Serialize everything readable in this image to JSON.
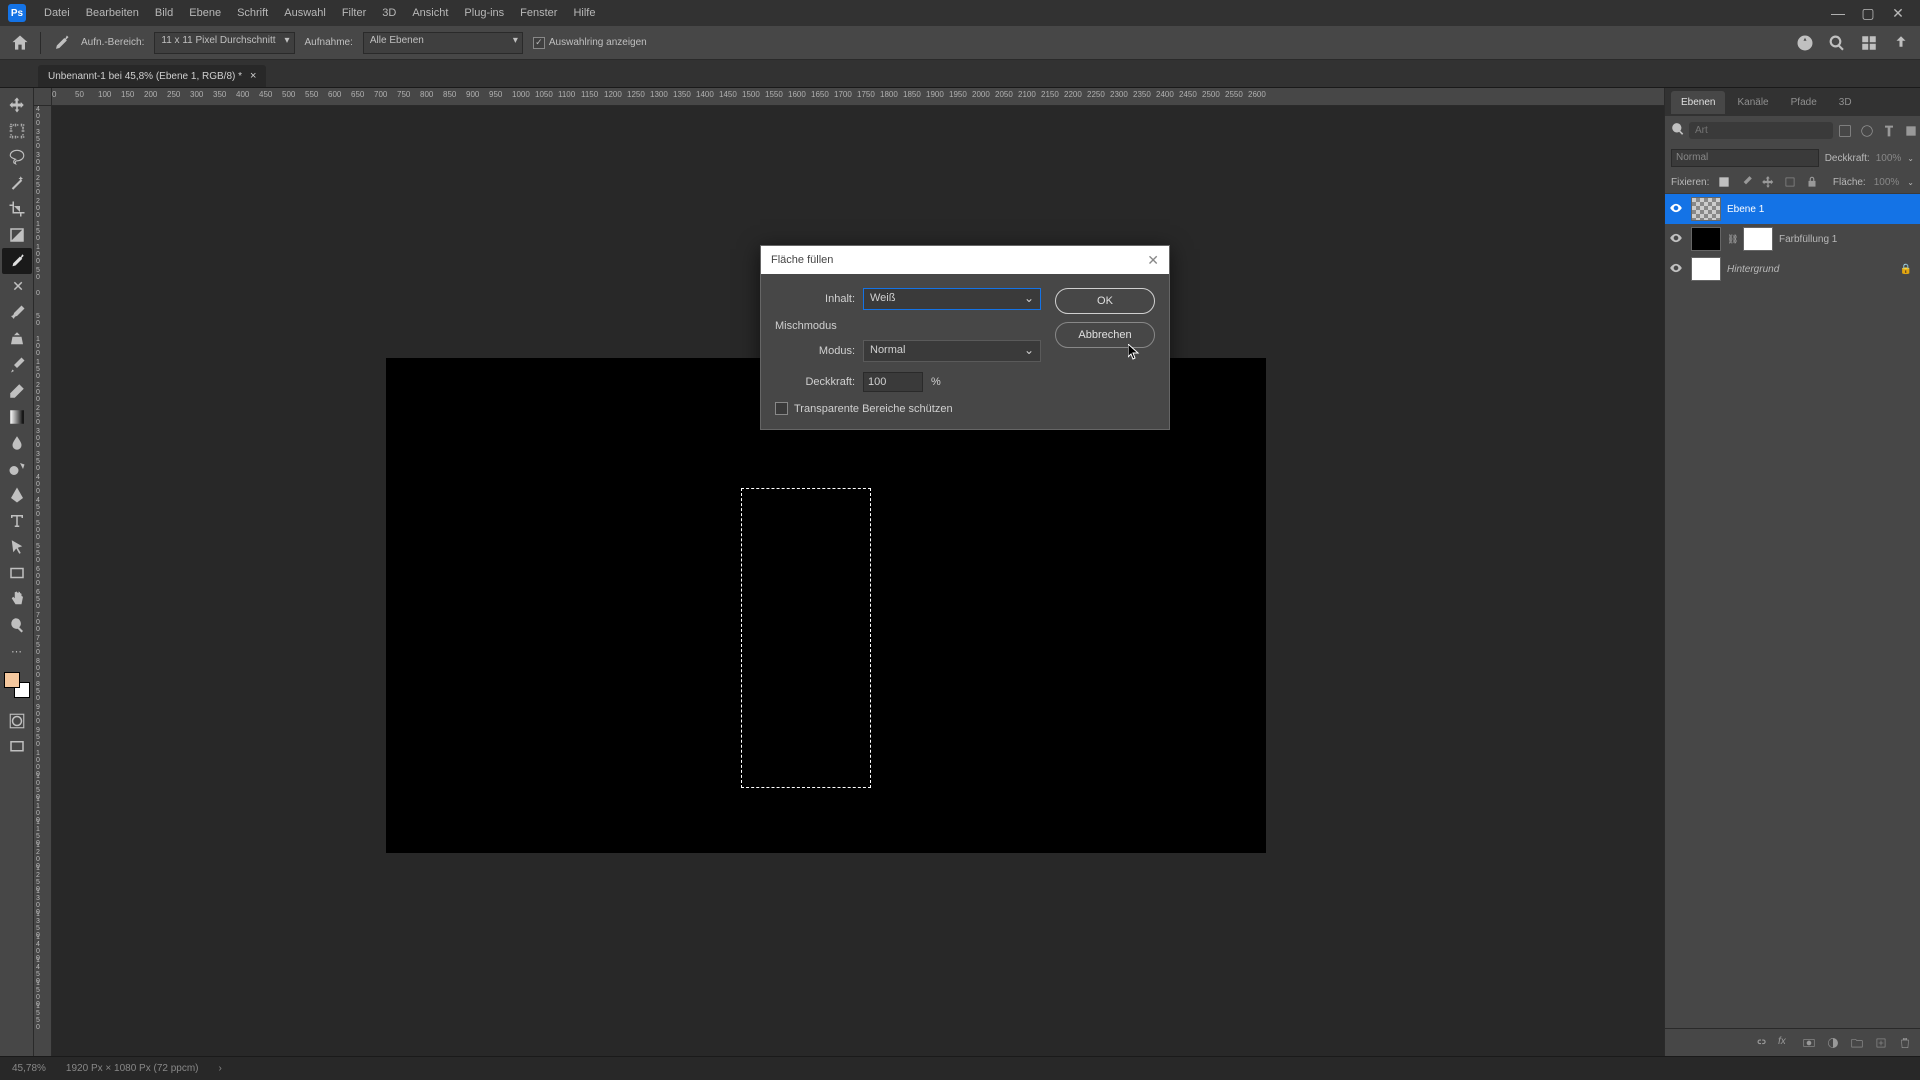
{
  "menubar": {
    "items": [
      "Datei",
      "Bearbeiten",
      "Bild",
      "Ebene",
      "Schrift",
      "Auswahl",
      "Filter",
      "3D",
      "Ansicht",
      "Plug-ins",
      "Fenster",
      "Hilfe"
    ]
  },
  "optionsbar": {
    "sample_label": "Aufn.-Bereich:",
    "sample_value": "11 x 11 Pixel Durchschnitt",
    "sample2_label": "Aufnahme:",
    "sample2_value": "Alle Ebenen",
    "checkbox_label": "Auswahlring anzeigen"
  },
  "doctab": {
    "title": "Unbenannt-1 bei 45,8% (Ebene 1, RGB/8) *"
  },
  "ruler_h": [
    "0",
    "50",
    "100",
    "150",
    "200",
    "250",
    "300",
    "350",
    "400",
    "450",
    "500",
    "550",
    "600",
    "650",
    "700",
    "750",
    "800",
    "850",
    "900",
    "950",
    "1000",
    "1050",
    "1100",
    "1150",
    "1200",
    "1250",
    "1300",
    "1350",
    "1400",
    "1450",
    "1500",
    "1550",
    "1600",
    "1650",
    "1700",
    "1750",
    "1800",
    "1850",
    "1900",
    "1950",
    "2000",
    "2050",
    "2100",
    "2150",
    "2200",
    "2250",
    "2300",
    "2350",
    "2400",
    "2450",
    "2500",
    "2550",
    "2600"
  ],
  "ruler_v": [
    "400",
    "350",
    "300",
    "250",
    "200",
    "150",
    "100",
    "50",
    "0",
    "50",
    "100",
    "150",
    "200",
    "250",
    "300",
    "350",
    "400",
    "450",
    "500",
    "550",
    "600",
    "650",
    "700",
    "750",
    "800",
    "850",
    "900",
    "950",
    "1000",
    "1050",
    "1100",
    "1150",
    "1200",
    "1250",
    "1300",
    "1350",
    "1400",
    "1450",
    "1500",
    "1550"
  ],
  "panels": {
    "tabs": [
      "Ebenen",
      "Kanäle",
      "Pfade",
      "3D"
    ],
    "search_placeholder": "Art",
    "blend_label": "Normal",
    "opacity_label": "Deckkraft:",
    "opacity_value": "100%",
    "lock_label": "Fixieren:",
    "fill_label": "Fläche:",
    "fill_value": "100%",
    "layers": [
      {
        "name": "Ebene 1",
        "thumb": "checker",
        "selected": true
      },
      {
        "name": "Farbfüllung 1",
        "thumb": "black",
        "mask": true
      },
      {
        "name": "Hintergrund",
        "thumb": "white",
        "locked": true,
        "italic": true
      }
    ]
  },
  "dialog": {
    "title": "Fläche füllen",
    "content_label": "Inhalt:",
    "content_value": "Weiß",
    "section_label": "Mischmodus",
    "mode_label": "Modus:",
    "mode_value": "Normal",
    "opacity_label": "Deckkraft:",
    "opacity_value": "100",
    "opacity_suffix": "%",
    "preserve_label": "Transparente Bereiche schützen",
    "ok": "OK",
    "cancel": "Abbrechen"
  },
  "statusbar": {
    "zoom": "45,78%",
    "docinfo": "1920 Px × 1080 Px (72 ppcm)"
  }
}
